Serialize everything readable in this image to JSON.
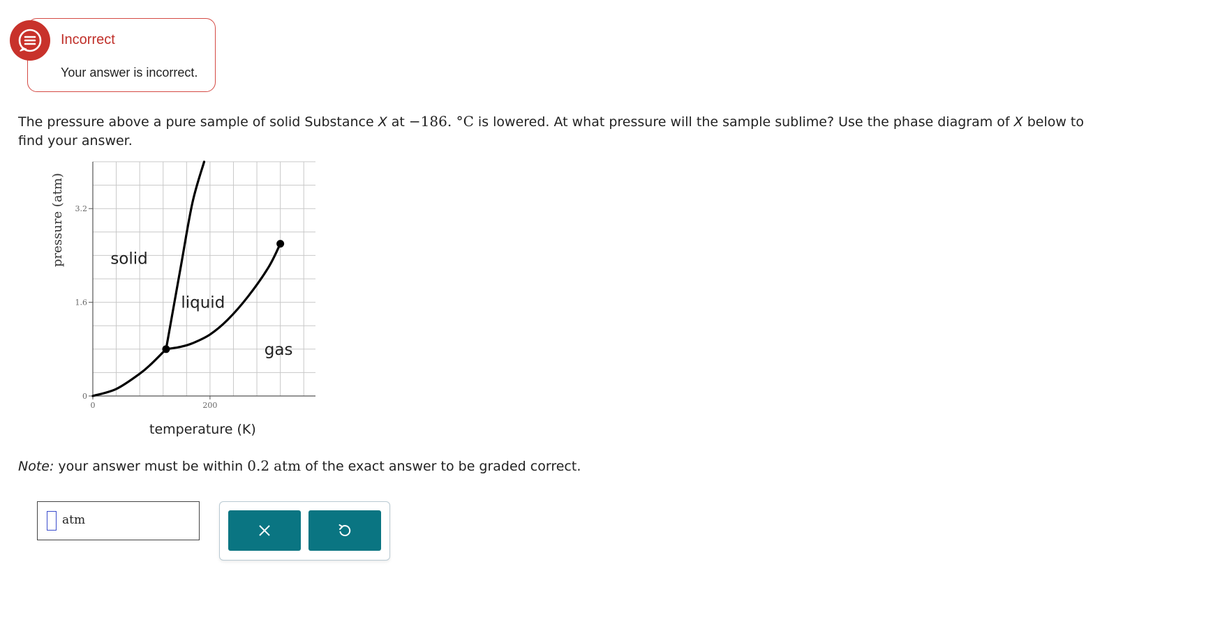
{
  "feedback": {
    "title": "Incorrect",
    "message": "Your answer is incorrect.",
    "icon": "message-bubble-icon",
    "color": "#c8322b"
  },
  "question": {
    "part1": "The pressure above a pure sample of solid Substance ",
    "variable": "X",
    "part2": " at ",
    "temperature": "−186. °C",
    "part3": " is lowered. At what pressure will the sample sublime? Use the phase diagram of ",
    "variable2": "X",
    "part4": " below to find your answer."
  },
  "chart_data": {
    "type": "line",
    "title": "",
    "xlabel": "temperature (K)",
    "ylabel": "pressure (atm)",
    "xlim": [
      0,
      380
    ],
    "ylim": [
      0,
      4.0
    ],
    "x_ticks": [
      {
        "value": 0,
        "label": "0"
      },
      {
        "value": 200,
        "label": "200"
      }
    ],
    "y_ticks": [
      {
        "value": 0,
        "label": "0"
      },
      {
        "value": 1.6,
        "label": "1.6"
      },
      {
        "value": 3.2,
        "label": "3.2"
      }
    ],
    "grid_x_step": 40,
    "grid_y_step": 0.4,
    "grid": true,
    "series": [
      {
        "x": [
          0,
          40,
          80,
          100,
          125
        ],
        "y": [
          0,
          0.12,
          0.38,
          0.55,
          0.8
        ]
      },
      {
        "x": [
          125,
          150,
          170,
          200,
          230,
          265,
          300,
          320
        ],
        "y": [
          0.8,
          0.84,
          0.9,
          1.05,
          1.3,
          1.7,
          2.2,
          2.6
        ]
      },
      {
        "x": [
          125,
          150,
          170,
          190
        ],
        "y": [
          0.8,
          2.2,
          3.3,
          4.0
        ]
      }
    ],
    "points": [
      {
        "name": "triple-point",
        "x": 125,
        "y": 0.8
      },
      {
        "name": "critical-point",
        "x": 320,
        "y": 2.6
      }
    ],
    "region_labels": [
      {
        "text": "solid",
        "x": 62,
        "y": 2.35
      },
      {
        "text": "liquid",
        "x": 188,
        "y": 1.6
      },
      {
        "text": "gas",
        "x": 317,
        "y": 0.8
      }
    ]
  },
  "note": {
    "prefix": "Note:",
    "text1": " your answer must be within ",
    "tolerance": "0.2",
    "unit": "atm",
    "text2": " of the exact answer to be graded correct."
  },
  "answer": {
    "value": "",
    "unit": "atm"
  },
  "buttons": {
    "clear_icon": "close-icon",
    "reset_icon": "undo-icon",
    "color": "#0a7582"
  }
}
